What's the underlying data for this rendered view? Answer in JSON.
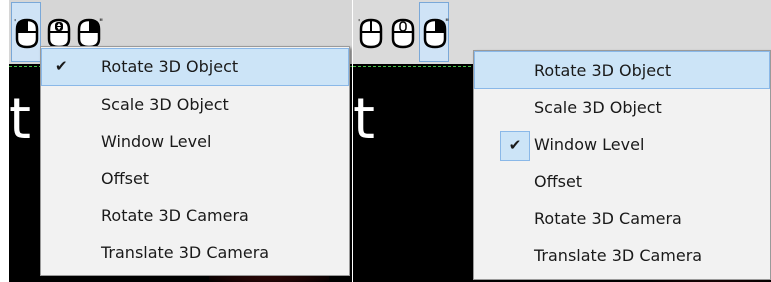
{
  "left_view": {
    "menu": {
      "items": [
        {
          "label": "Rotate 3D Object",
          "checked": true
        },
        {
          "label": "Scale 3D Object",
          "checked": false
        },
        {
          "label": "Window Level",
          "checked": false
        },
        {
          "label": "Offset",
          "checked": false
        },
        {
          "label": "Rotate 3D Camera",
          "checked": false
        },
        {
          "label": "Translate 3D Camera",
          "checked": false
        }
      ]
    },
    "active_tool": "mouse-left-icon",
    "checkmark": "✔"
  },
  "right_view": {
    "menu": {
      "items": [
        {
          "label": "Rotate 3D Object",
          "checked": false
        },
        {
          "label": "Scale 3D Object",
          "checked": false
        },
        {
          "label": "Window Level",
          "checked": true
        },
        {
          "label": "Offset",
          "checked": false
        },
        {
          "label": "Rotate 3D Camera",
          "checked": false
        },
        {
          "label": "Translate 3D Camera",
          "checked": false
        }
      ]
    },
    "active_tool": "mouse-right-icon",
    "checkmark": "✔"
  },
  "viewport_text": "t",
  "colors": {
    "highlight": "#cce4f7",
    "highlight_border": "#8ab8e8",
    "menu_bg": "#f2f2f2",
    "toolbar": "#d6d6d6"
  }
}
